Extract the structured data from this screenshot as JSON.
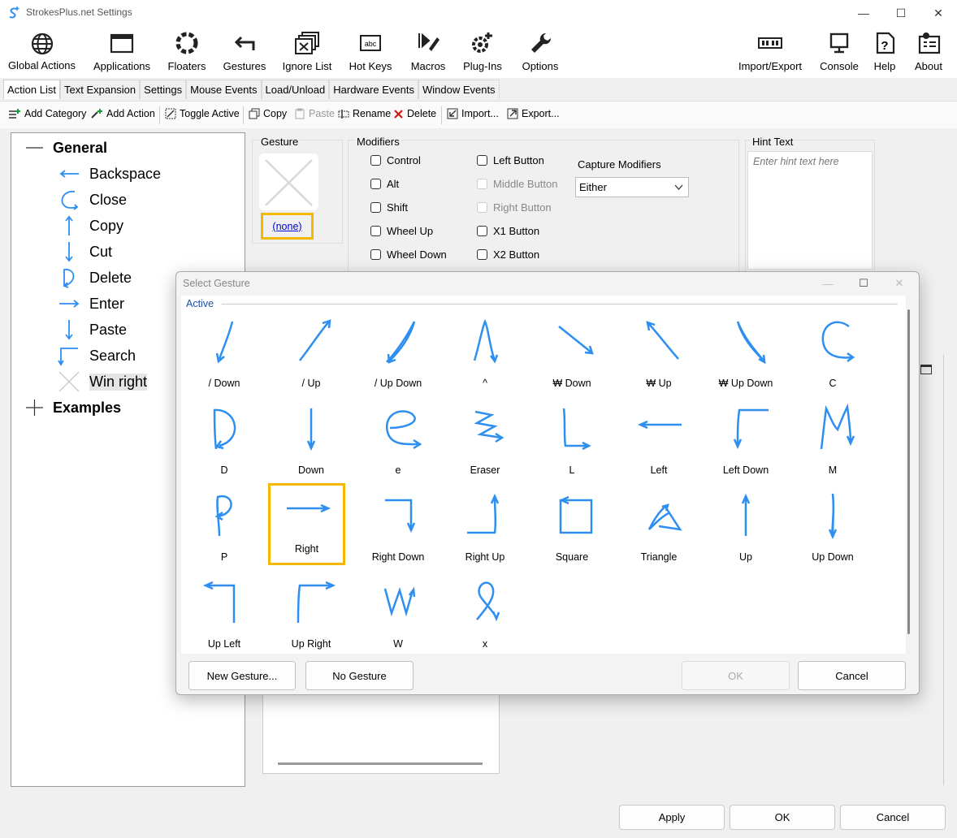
{
  "window": {
    "title": "StrokesPlus.net Settings",
    "minimize": "—",
    "maximize": "☐",
    "close": "✕"
  },
  "ribbon": {
    "items": [
      {
        "label": "Global Actions",
        "icon": "globe-icon"
      },
      {
        "label": "Applications",
        "icon": "window-icon"
      },
      {
        "label": "Floaters",
        "icon": "floater-ring-icon"
      },
      {
        "label": "Gestures",
        "icon": "gesture-arrow-icon"
      },
      {
        "label": "Ignore List",
        "icon": "ignore-stack-icon"
      },
      {
        "label": "Hot Keys",
        "icon": "keyboard-key-icon"
      },
      {
        "label": "Macros",
        "icon": "macro-icon"
      },
      {
        "label": "Plug-Ins",
        "icon": "plugin-gear-icon"
      },
      {
        "label": "Options",
        "icon": "wrench-icon"
      },
      {
        "label": "Import/Export",
        "icon": "import-export-icon"
      },
      {
        "label": "Console",
        "icon": "monitor-icon"
      },
      {
        "label": "Help",
        "icon": "help-icon"
      },
      {
        "label": "About",
        "icon": "about-icon"
      }
    ]
  },
  "subtabs": [
    "Action List",
    "Text Expansion",
    "Settings",
    "Mouse Events",
    "Load/Unload",
    "Hardware Events",
    "Window Events"
  ],
  "toolbar": {
    "add_category": "Add Category",
    "add_action": "Add Action",
    "toggle_active": "Toggle Active",
    "copy": "Copy",
    "paste": "Paste",
    "rename": "Rename",
    "delete": "Delete",
    "import": "Import...",
    "export": "Export..."
  },
  "tree": {
    "category_general": "General",
    "actions": [
      "Backspace",
      "Close",
      "Copy",
      "Cut",
      "Delete",
      "Enter",
      "Paste",
      "Search",
      "Win right"
    ],
    "category_examples": "Examples"
  },
  "gesture_panel": {
    "title": "Gesture",
    "link": "(none)"
  },
  "modifiers": {
    "title": "Modifiers",
    "left_col": [
      "Control",
      "Alt",
      "Shift",
      "Wheel Up",
      "Wheel Down"
    ],
    "right_col": [
      "Left Button",
      "Middle Button",
      "Right Button",
      "X1 Button",
      "X2 Button"
    ],
    "capture_label": "Capture Modifiers",
    "capture_value": "Either"
  },
  "hint": {
    "title": "Hint Text",
    "placeholder": "Enter hint text here"
  },
  "footer": {
    "apply": "Apply",
    "ok": "OK",
    "cancel": "Cancel"
  },
  "dialog": {
    "title": "Select Gesture",
    "group_label": "Active",
    "gestures": [
      "/ Down",
      "/ Up",
      "/ Up Down",
      "^",
      "₩ Down",
      "₩ Up",
      "₩ Up Down",
      "C",
      "D",
      "Down",
      "e",
      "Eraser",
      "L",
      "Left",
      "Left Down",
      "M",
      "P",
      "Right",
      "Right Down",
      "Right Up",
      "Square",
      "Triangle",
      "Up",
      "Up Down",
      "Up Left",
      "Up Right",
      "W",
      "x"
    ],
    "selected_gesture": "Right",
    "new_gesture": "New Gesture...",
    "no_gesture": "No Gesture",
    "ok": "OK",
    "cancel": "Cancel"
  },
  "colors": {
    "gesture_stroke": "#2e8ff0",
    "selection_highlight": "#f5b800",
    "link": "#0000d0"
  }
}
